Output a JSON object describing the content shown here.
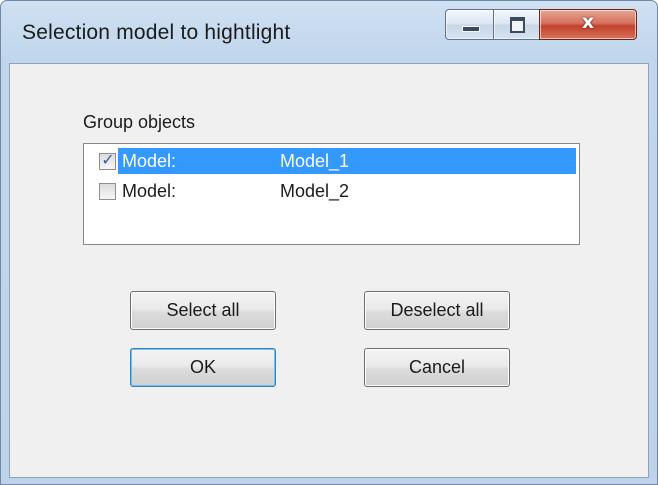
{
  "window": {
    "title": "Selection model to hightlight"
  },
  "caption": {
    "minimize_icon": "minimize-icon",
    "maximize_icon": "maximize-icon",
    "close_glyph": "x"
  },
  "group": {
    "label": "Group objects",
    "items": [
      {
        "type": "Model:",
        "name": "Model_1",
        "checked": true,
        "selected": true
      },
      {
        "type": "Model:",
        "name": "Model_2",
        "checked": false,
        "selected": false
      }
    ]
  },
  "buttons": {
    "select_all": "Select all",
    "deselect_all": "Deselect all",
    "ok": "OK",
    "cancel": "Cancel"
  },
  "colors": {
    "selection": "#3399ff",
    "title_bar": "#c1d6ec",
    "close_button": "#c3432b"
  }
}
